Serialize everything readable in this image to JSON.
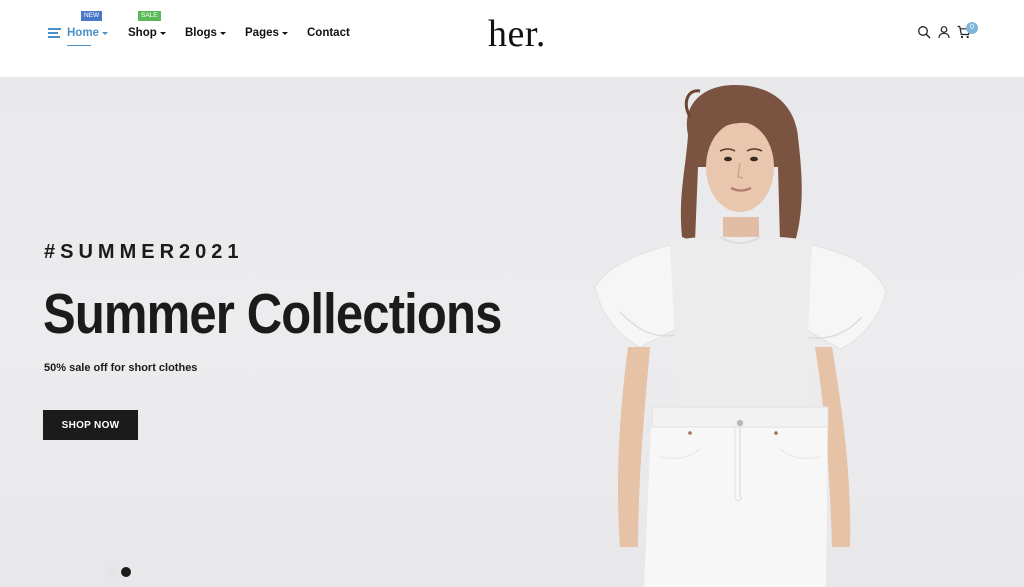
{
  "header": {
    "logo": "her.",
    "nav": [
      {
        "label": "Home",
        "badge": "NEW",
        "active": true
      },
      {
        "label": "Shop",
        "badge": "SALE"
      },
      {
        "label": "Blogs"
      },
      {
        "label": "Pages"
      },
      {
        "label": "Contact"
      }
    ],
    "icons": [
      "search-icon",
      "user-icon",
      "cart-icon"
    ],
    "cart_count": "0"
  },
  "hero": {
    "tag": "#SUMMER2021",
    "headline": "Summer Collections",
    "subtext": "50% sale off for short clothes",
    "button_label": "SHOP NOW",
    "slides": 2,
    "active_slide": 2
  },
  "colors": {
    "accent": "#4a90c8",
    "badge_new": "#4a78c8",
    "badge_sale": "#5aba5a",
    "dark": "#1b1b1b",
    "cart_badge": "#7fb6d9"
  }
}
